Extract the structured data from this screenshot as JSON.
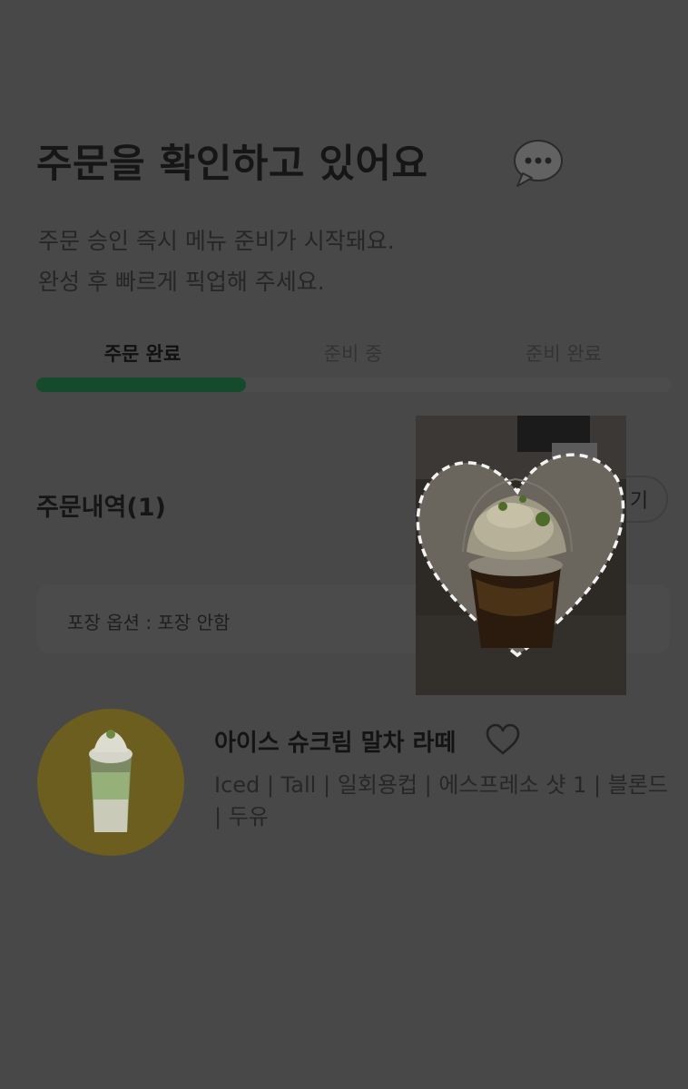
{
  "header": {
    "title": "주문을 확인하고 있어요",
    "title_icon": "chat-bubble-icon",
    "subtitle_lines": [
      "주문 승인 즉시 메뉴 준비가 시작돼요.",
      "완성 후 빠르게 픽업해 주세요."
    ]
  },
  "status": {
    "tabs": [
      {
        "label": "주문 완료",
        "active": true
      },
      {
        "label": "준비 중",
        "active": false
      },
      {
        "label": "준비 완료",
        "active": false
      }
    ],
    "progress": 0.33,
    "accent": "#154a2d"
  },
  "order": {
    "section_title": "주문내역(1)",
    "receipt_button_visible": "기",
    "packaging_option": "포장 옵션 : 포장 안함",
    "item": {
      "name": "아이스 슈크림 말차 라떼",
      "options": "Iced | Tall | 일회용컵 | 에스프레소 샷 1 | 블론드 | 두유",
      "favorite_icon": "heart-outline-icon"
    }
  },
  "overlay_photo": {
    "description_icon": "whipped-cream-drink-photo"
  }
}
